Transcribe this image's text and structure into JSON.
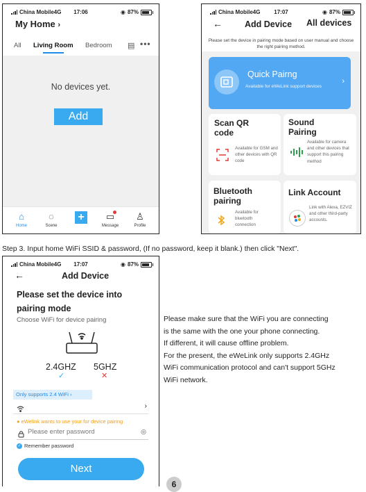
{
  "phone1": {
    "status": {
      "carrier": "China Mobile4G",
      "time": "17:06",
      "battery": "87%"
    },
    "title": "My Home",
    "title_chevron": "›",
    "tabs": [
      "All",
      "Living Room",
      "Bedroom"
    ],
    "active_tab": "Living Room",
    "empty_text": "No devices yet.",
    "add_button": "Add",
    "nav": [
      {
        "label": "Home",
        "icon": "home-icon"
      },
      {
        "label": "Scene",
        "icon": "scene-icon"
      },
      {
        "label": "",
        "icon": "plus-icon"
      },
      {
        "label": "Message",
        "icon": "message-icon"
      },
      {
        "label": "Profile",
        "icon": "profile-icon"
      }
    ]
  },
  "phone2": {
    "status": {
      "carrier": "China Mobile4G",
      "time": "17:07",
      "battery": "87%"
    },
    "back": "←",
    "title": "Add Device",
    "all_devices": "All devices",
    "instruction": "Please set the device in pairing mode based on user manual and choose the right pairing method.",
    "quick": {
      "title": "Quick Pairng",
      "subtitle": "Available for eWeLink support devices",
      "chevron": "›"
    },
    "cards": [
      {
        "title": "Scan QR code",
        "desc": "Available for GSM and other devices with QR code",
        "icon": "qr-scan-icon"
      },
      {
        "title": "Sound Pairing",
        "desc": "Available for camera and other devices that support this pairing method",
        "icon": "sound-wave-icon"
      },
      {
        "title": "Bluetooth pairing",
        "desc": "Available for bluetooth connection",
        "icon": "bluetooth-icon"
      },
      {
        "title": "Link Account",
        "desc": "Link with Alexa, EZVIZ and other third-party accounts.",
        "icon": "link-account-icon"
      }
    ]
  },
  "step3": "Step 3. Input home WiFi SSID & password, (If no password, keep it blank.) then click \"Next\".",
  "phone3": {
    "status": {
      "carrier": "China Mobile4G",
      "time": "17:07",
      "battery": "87%"
    },
    "back": "←",
    "title": "Add Device",
    "heading": "Please set the device into pairing mode",
    "subheading": "Choose WiFi for device pairing",
    "band_24": "2.4GHZ",
    "band_5": "5GHZ",
    "only_supports": "Only supports 2.4 WiFi ›",
    "wifi_chevron": "›",
    "warning": "eWelink wants to use your for device pairing",
    "password_placeholder": "Please enter password",
    "remember": "Remember password",
    "next_button": "Next"
  },
  "prose": [
    "Please make sure that the WiFi you are connecting",
    "is the same with the one your phone connecting.",
    "If different, it will cause offline problem.",
    "For the present, the eWeLink only supports 2.4GHz",
    "WiFi communication protocol and can't support 5GHz",
    "WiFi network."
  ],
  "page_number": "6",
  "colors": {
    "accent": "#3aaaf0",
    "blue_card": "#52a8f2",
    "gray_bg": "#f0f0f0",
    "error": "#e53935",
    "warning": "#f39c12"
  }
}
